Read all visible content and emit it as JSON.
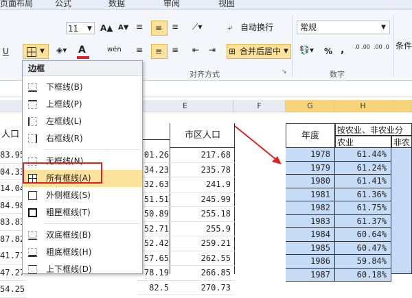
{
  "tabs": [
    "页面布局",
    "公式",
    "数据",
    "审阅",
    "视图"
  ],
  "ribbon": {
    "font_size": "11",
    "grow_font_icon": "A▲",
    "shrink_font_icon": "A▼",
    "wrap_text_label": "自动换行",
    "merge_center_label": "合并后居中",
    "number_format": "常规",
    "percent": "%",
    "comma": ",",
    "align_group_label": "对齐方式",
    "number_group_label": "数字",
    "cond_format_label": "条件",
    "inc_decimal": ".0 .00",
    "dec_decimal": ".00 .0",
    "font_color_letter": "A",
    "underline_letter": "U",
    "phonetic_label": "wén"
  },
  "columns": [
    "E",
    "F",
    "G",
    "H"
  ],
  "left_col_values": [
    "83.95",
    "04.33",
    "14.04",
    "84.98",
    "83.83",
    "87.82",
    "41.71",
    "47.27",
    "54.25"
  ],
  "left_header_text": "人口",
  "mid_col_values": [
    "01.26",
    "34.23",
    "32.63",
    "51.51",
    "50.89",
    "52.71",
    "52.42",
    "57.65",
    "78.19",
    "82.5"
  ],
  "mid_header_text": ")",
  "e_header": "市区人口",
  "e_values": [
    "217.68",
    "235.78",
    "241.9",
    "245.99",
    "255.18",
    "255.9",
    "259.21",
    "262.55",
    "266.85",
    "270.73"
  ],
  "g_header": "年度",
  "h_header_top": "按农业、非农业分",
  "h_header_sub1": "农业",
  "h_header_sub2": "非农",
  "years": [
    "1978",
    "1979",
    "1980",
    "1981",
    "1982",
    "1983",
    "1984",
    "1985",
    "1986",
    "1987"
  ],
  "h_values": [
    "61.44%",
    "61.24%",
    "61.41%",
    "61.36%",
    "61.75%",
    "61.37%",
    "60.64%",
    "60.47%",
    "59.84%",
    "60.18%"
  ],
  "menu": {
    "title": "边框",
    "items": [
      {
        "label": "下框线(B)",
        "icon": "border-bottom-icon"
      },
      {
        "label": "上框线(P)",
        "icon": "border-top-icon"
      },
      {
        "label": "左框线(L)",
        "icon": "border-left-icon"
      },
      {
        "label": "右框线(R)",
        "icon": "border-right-icon"
      },
      {
        "label": "无框线(N)",
        "icon": "no-border-icon"
      },
      {
        "label": "所有框线(A)",
        "icon": "all-borders-icon"
      },
      {
        "label": "外侧框线(S)",
        "icon": "outside-borders-icon"
      },
      {
        "label": "粗匣框线(T)",
        "icon": "thick-box-border-icon"
      },
      {
        "label": "双底框线(B)",
        "icon": "double-bottom-border-icon"
      },
      {
        "label": "粗底框线(H)",
        "icon": "thick-bottom-border-icon"
      },
      {
        "label": "上下框线(D)",
        "icon": "top-bottom-border-icon"
      }
    ]
  },
  "colors": {
    "selection_blue": "#c6dcf6",
    "highlight_red": "#e02020",
    "menu_hover": "#fde29b"
  }
}
